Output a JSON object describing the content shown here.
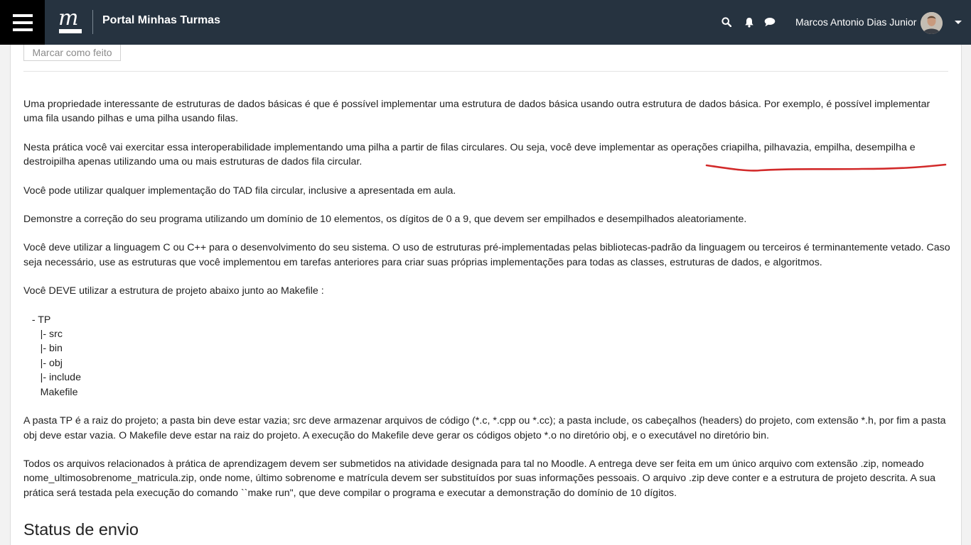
{
  "navbar": {
    "brand": "Portal Minhas Turmas",
    "user_name": "Marcos Antonio Dias Junior",
    "icons": [
      "menu-icon",
      "search-icon",
      "bell-icon",
      "chat-icon",
      "caret-down-icon"
    ]
  },
  "activity": {
    "mark_done_label": "Marcar como feito"
  },
  "description": {
    "paragraphs": [
      "Uma propriedade interessante de estruturas de dados básicas é que é possível implementar uma estrutura de dados básica usando outra estrutura de dados básica. Por exemplo, é possível implementar uma fila usando pilhas e uma pilha usando filas.",
      "Nesta prática você vai exercitar essa interoperabilidade implementando uma pilha a partir de filas circulares. Ou seja, você deve implementar as operações criapilha, pilhavazia, empilha, desempilha e destroipilha apenas utilizando uma ou mais estruturas de dados fila circular.",
      "Você pode utilizar qualquer implementação do TAD fila circular, inclusive a apresentada em aula.",
      "Demonstre a correção do seu programa utilizando um domínio de 10 elementos, os dígitos de 0 a 9, que devem ser empilhados e desempilhados aleatoriamente.",
      "Você deve utilizar a linguagem C ou C++ para o desenvolvimento do seu sistema. O uso de estruturas pré-implementadas pelas bibliotecas-padrão da linguagem ou terceiros é terminantemente vetado. Caso seja necessário, use as estruturas que você implementou em tarefas anteriores para criar suas próprias implementações para todas as classes, estruturas de dados, e algoritmos.",
      "Você DEVE utilizar a estrutura de projeto abaixo junto ao Makefile :"
    ],
    "project_tree": "   - TP\n      |- src\n      |- bin\n      |- obj\n      |- include\n      Makefile",
    "paragraphs_after": [
      "A pasta TP é a raiz do projeto; a pasta bin deve estar vazia; src deve armazenar arquivos de código (*.c, *.cpp ou *.cc); a pasta include, os cabeçalhos (headers) do projeto, com extensão *.h, por fim a pasta obj deve estar vazia. O Makefile deve estar na raiz do projeto. A execução do Makefile deve gerar os códigos objeto *.o no diretório obj, e o executável no diretório bin.",
      "Todos os arquivos relacionados à prática de aprendizagem devem ser submetidos na atividade designada para tal no Moodle. A entrega deve ser feita em um único arquivo com extensão .zip, nomeado nome_ultimosobrenome_matricula.zip, onde nome, último sobrenome e matrícula devem ser substituídos por suas informações pessoais. O arquivo .zip deve conter e a estrutura de projeto descrita. A sua prática será testada pela execução do comando ``make run\", que deve compilar o programa e executar a demonstração do domínio de 10 dígitos."
    ]
  },
  "submission": {
    "title": "Status de envio"
  },
  "colors": {
    "navbar": "#263340",
    "menu_button": "#000000",
    "annotation_stroke": "#d22a2a"
  }
}
